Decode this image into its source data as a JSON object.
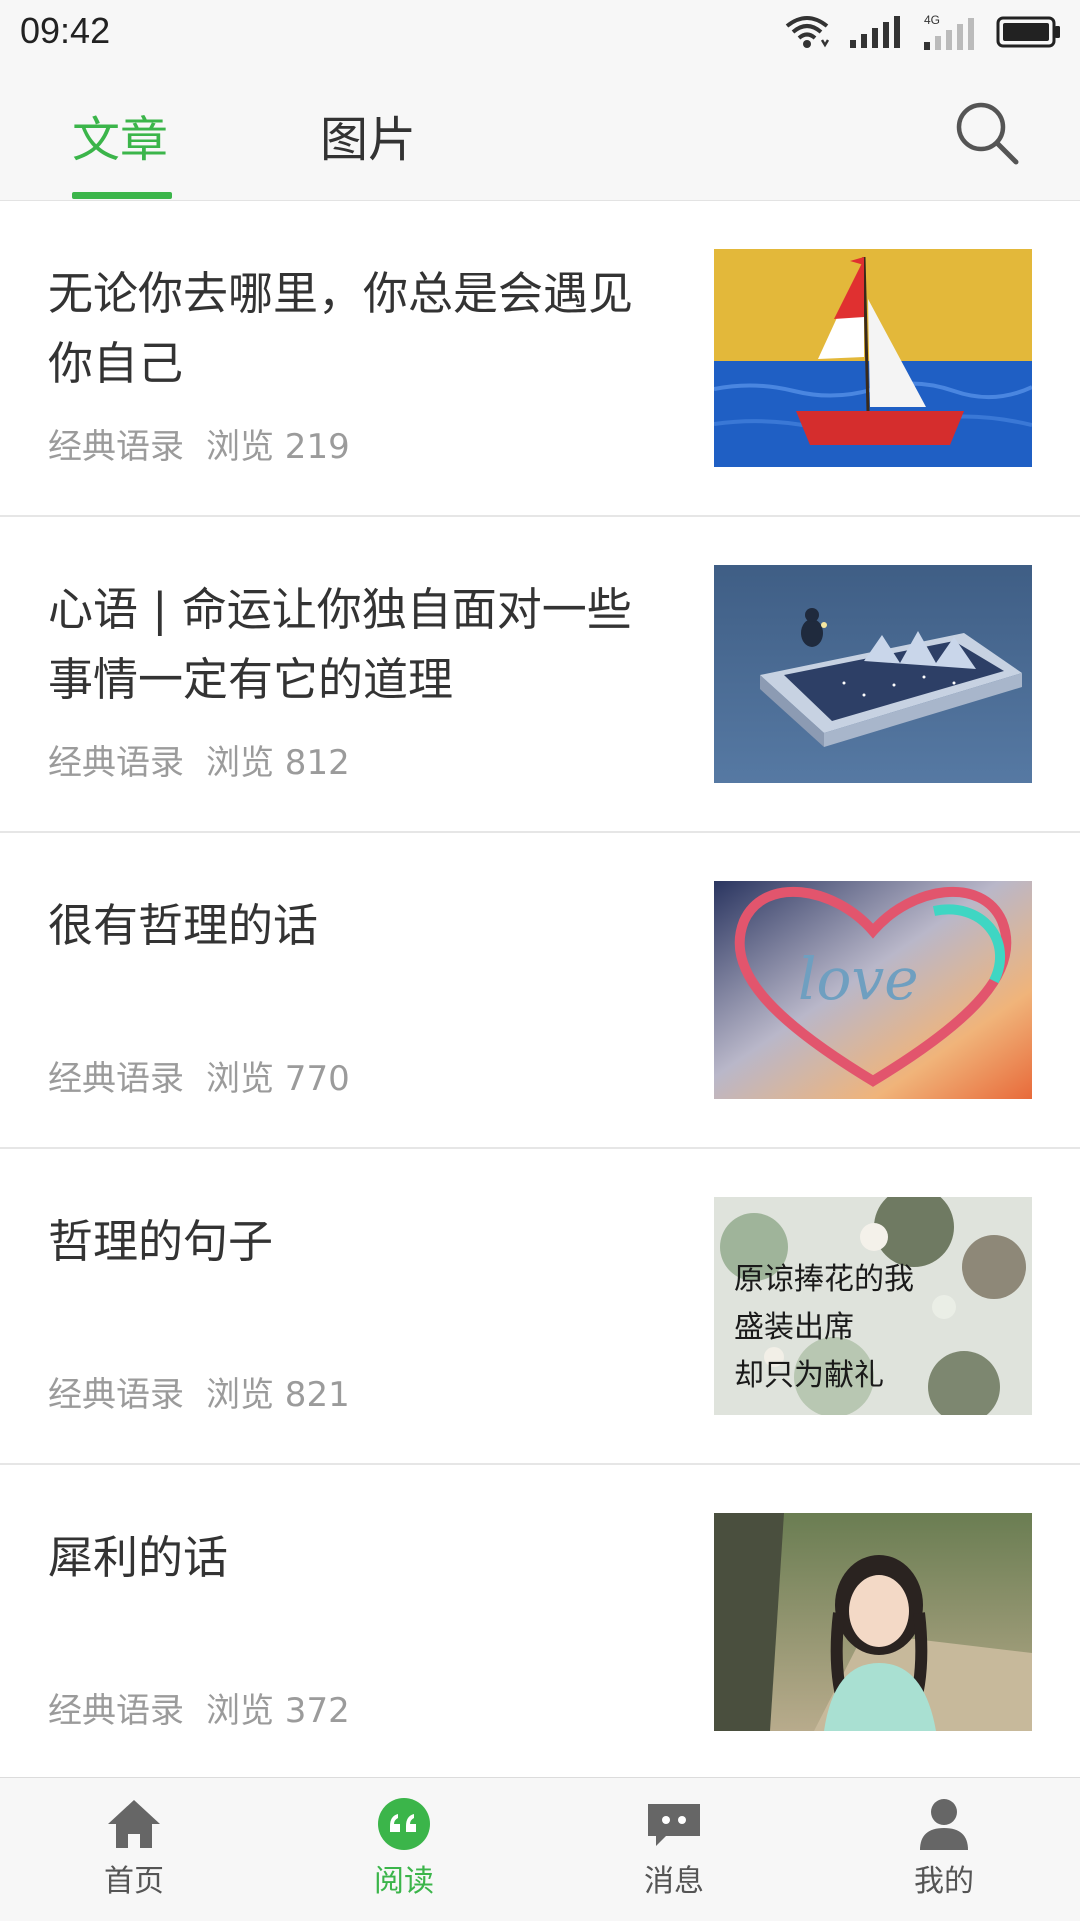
{
  "status_bar": {
    "time": "09:42",
    "network_label": "4G"
  },
  "top_tabs": [
    {
      "label": "文章",
      "active": true
    },
    {
      "label": "图片",
      "active": false
    }
  ],
  "accent_color": "#3bb54a",
  "articles": [
    {
      "title": "无论你去哪里，你总是会遇见你自己",
      "category": "经典语录",
      "views": "浏览 219",
      "thumbnail": "sailboat"
    },
    {
      "title": "心语 | 命运让你独自面对一些事情一定有它的道理",
      "category": "经典语录",
      "views": "浏览 812",
      "thumbnail": "book-lake-night"
    },
    {
      "title": "很有哲理的话",
      "category": "经典语录",
      "views": "浏览 770",
      "thumbnail": "love-heart"
    },
    {
      "title": "哲理的句子",
      "category": "经典语录",
      "views": "浏览 821",
      "thumbnail": "flowers-calligraphy",
      "thumbnail_text": [
        "原谅捧花的我",
        "盛装出席",
        "却只为献礼"
      ]
    },
    {
      "title": "犀利的话",
      "category": "经典语录",
      "views": "浏览 372",
      "thumbnail": "girl-portrait"
    }
  ],
  "bottom_nav": [
    {
      "label": "首页",
      "icon": "home-icon",
      "active": false
    },
    {
      "label": "阅读",
      "icon": "quote-icon",
      "active": true
    },
    {
      "label": "消息",
      "icon": "message-icon",
      "active": false
    },
    {
      "label": "我的",
      "icon": "person-icon",
      "active": false
    }
  ]
}
